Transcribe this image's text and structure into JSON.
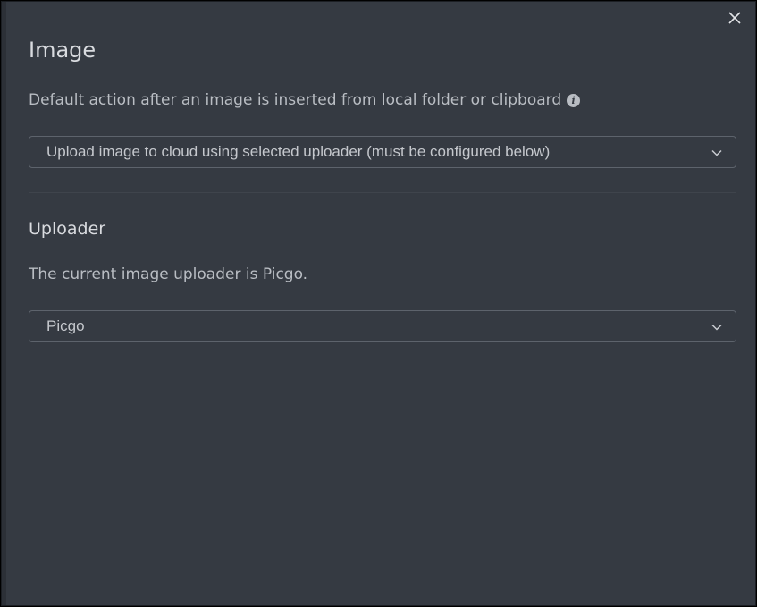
{
  "window": {
    "close_icon": "close-icon"
  },
  "image_section": {
    "title": "Image",
    "description": "Default action after an image is inserted from local folder or clipboard",
    "info_icon": "info-icon",
    "info_glyph": "i",
    "default_action_value": "Upload image to cloud using selected uploader (must be configured below)"
  },
  "uploader_section": {
    "title": "Uploader",
    "description": "The current image uploader is Picgo.",
    "uploader_value": "Picgo"
  },
  "colors": {
    "background": "#353a42",
    "text": "#c9ccd1",
    "border": "#5d636c"
  }
}
